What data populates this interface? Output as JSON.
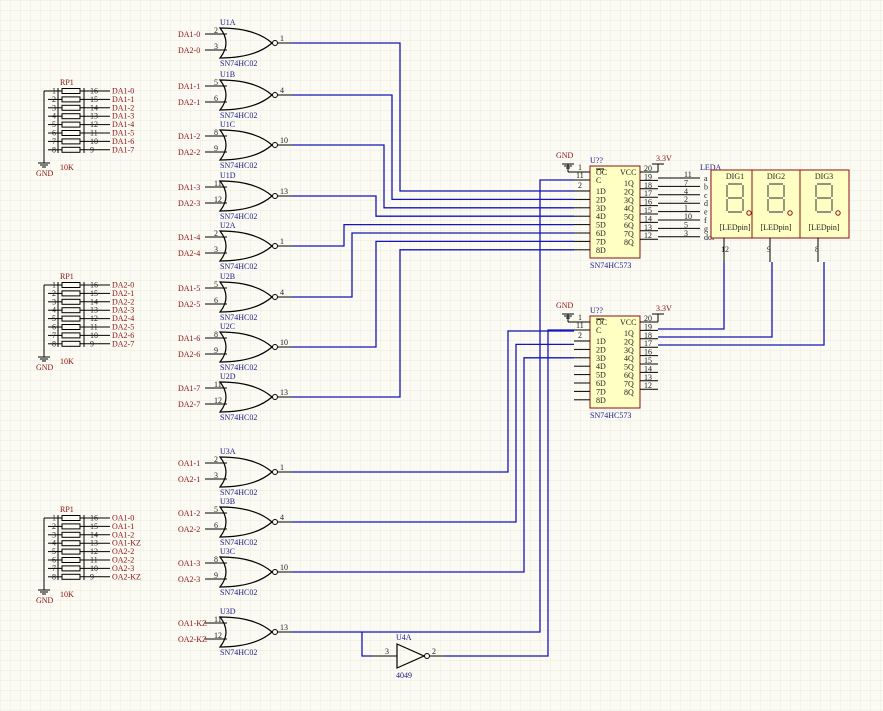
{
  "resistor_packs": [
    {
      "ref": "RP1",
      "value": "10K",
      "gnd": "GND",
      "left_pins": [
        "1",
        "2",
        "3",
        "4",
        "5",
        "6",
        "7",
        "8"
      ],
      "right_pins": [
        "16",
        "15",
        "14",
        "13",
        "12",
        "11",
        "10",
        "9"
      ],
      "nets": [
        "DA1-0",
        "DA1-1",
        "DA1-2",
        "DA1-3",
        "DA1-4",
        "DA1-5",
        "DA1-6",
        "DA1-7"
      ]
    },
    {
      "ref": "RP1",
      "value": "10K",
      "gnd": "GND",
      "left_pins": [
        "1",
        "2",
        "3",
        "4",
        "5",
        "6",
        "7",
        "8"
      ],
      "right_pins": [
        "16",
        "15",
        "14",
        "13",
        "12",
        "11",
        "10",
        "9"
      ],
      "nets": [
        "DA2-0",
        "DA2-1",
        "DA2-2",
        "DA2-3",
        "DA2-4",
        "DA2-5",
        "DA2-6",
        "DA2-7"
      ]
    },
    {
      "ref": "RP1",
      "value": "10K",
      "gnd": "GND",
      "left_pins": [
        "1",
        "2",
        "3",
        "4",
        "5",
        "6",
        "7",
        "8"
      ],
      "right_pins": [
        "16",
        "15",
        "14",
        "13",
        "12",
        "11",
        "10",
        "9"
      ],
      "nets": [
        "OA1-0",
        "OA1-1",
        "OA1-2",
        "OA1-KZ",
        "OA2-2",
        "OA2-2",
        "OA2-3",
        "OA2-KZ"
      ]
    }
  ],
  "gates": [
    {
      "ref": "U1A",
      "part": "SN74HC02",
      "in1": "DA1-0",
      "in2": "DA2-0",
      "p1": "2",
      "p2": "3",
      "pout": "1"
    },
    {
      "ref": "U1B",
      "part": "SN74HC02",
      "in1": "DA1-1",
      "in2": "DA2-1",
      "p1": "5",
      "p2": "6",
      "pout": "4"
    },
    {
      "ref": "U1C",
      "part": "SN74HC02",
      "in1": "DA1-2",
      "in2": "DA2-2",
      "p1": "8",
      "p2": "9",
      "pout": "10"
    },
    {
      "ref": "U1D",
      "part": "SN74HC02",
      "in1": "DA1-3",
      "in2": "DA2-3",
      "p1": "11",
      "p2": "12",
      "pout": "13"
    },
    {
      "ref": "U2A",
      "part": "SN74HC02",
      "in1": "DA1-4",
      "in2": "DA2-4",
      "p1": "2",
      "p2": "3",
      "pout": "1"
    },
    {
      "ref": "U2B",
      "part": "SN74HC02",
      "in1": "DA1-5",
      "in2": "DA2-5",
      "p1": "5",
      "p2": "6",
      "pout": "4"
    },
    {
      "ref": "U2C",
      "part": "SN74HC02",
      "in1": "DA1-6",
      "in2": "DA2-6",
      "p1": "8",
      "p2": "9",
      "pout": "10"
    },
    {
      "ref": "U2D",
      "part": "SN74HC02",
      "in1": "DA1-7",
      "in2": "DA2-7",
      "p1": "11",
      "p2": "12",
      "pout": "13"
    },
    {
      "ref": "U3A",
      "part": "SN74HC02",
      "in1": "OA1-1",
      "in2": "OA2-1",
      "p1": "2",
      "p2": "3",
      "pout": "1"
    },
    {
      "ref": "U3B",
      "part": "SN74HC02",
      "in1": "OA1-2",
      "in2": "OA2-2",
      "p1": "5",
      "p2": "6",
      "pout": "4"
    },
    {
      "ref": "U3C",
      "part": "SN74HC02",
      "in1": "OA1-3",
      "in2": "OA2-3",
      "p1": "8",
      "p2": "9",
      "pout": "10"
    },
    {
      "ref": "U3D",
      "part": "SN74HC02",
      "in1": "OA1-KZ",
      "in2": "OA2-KZ",
      "p1": "11",
      "p2": "12",
      "pout": "13"
    }
  ],
  "latches": [
    {
      "ref": "U??",
      "part": "SN74HC573",
      "gnd": "GND",
      "supply": "3.3V",
      "oc": "OC",
      "c": "C",
      "vcc": "VCC",
      "d_pins": [
        "1D",
        "2D",
        "3D",
        "4D",
        "5D",
        "6D",
        "7D",
        "8D"
      ],
      "q_pins": [
        "1Q",
        "2Q",
        "3Q",
        "4Q",
        "5Q",
        "6Q",
        "7Q",
        "8Q"
      ],
      "left_nums": [
        "1",
        "11",
        "2",
        "3",
        "4",
        "5",
        "6",
        "7",
        "8",
        "9"
      ],
      "right_nums": [
        "20",
        "19",
        "18",
        "17",
        "16",
        "15",
        "14",
        "13",
        "12"
      ]
    },
    {
      "ref": "U??",
      "part": "SN74HC573",
      "gnd": "GND",
      "supply": "3.3V",
      "oc": "OC",
      "c": "C",
      "vcc": "VCC",
      "d_pins": [
        "1D",
        "2D",
        "3D",
        "4D",
        "5D",
        "6D",
        "7D",
        "8D"
      ],
      "q_pins": [
        "1Q",
        "2Q",
        "3Q",
        "4Q",
        "5Q",
        "6Q",
        "7Q",
        "8Q"
      ],
      "left_nums": [
        "1",
        "11",
        "2",
        "3",
        "4",
        "5",
        "6",
        "7",
        "8",
        "9"
      ],
      "right_nums": [
        "20",
        "19",
        "18",
        "17",
        "16",
        "15",
        "14",
        "13",
        "12"
      ]
    }
  ],
  "display": {
    "ref": "LEDA",
    "seg_letters": [
      "a",
      "b",
      "c",
      "d",
      "e",
      "f",
      "g",
      "dot"
    ],
    "seg_pins": [
      "11",
      "7",
      "4",
      "2",
      "1",
      "10",
      "5",
      "3"
    ],
    "digits": [
      {
        "label": "DIG1",
        "name": "[LEDpin]",
        "pin": "12"
      },
      {
        "label": "DIG2",
        "name": "[LEDpin]",
        "pin": "9"
      },
      {
        "label": "DIG3",
        "name": "[LEDpin]",
        "pin": "8"
      }
    ]
  },
  "inverter": {
    "ref": "U4A",
    "part": "4049",
    "pin_in": "3",
    "pin_out": "2"
  }
}
